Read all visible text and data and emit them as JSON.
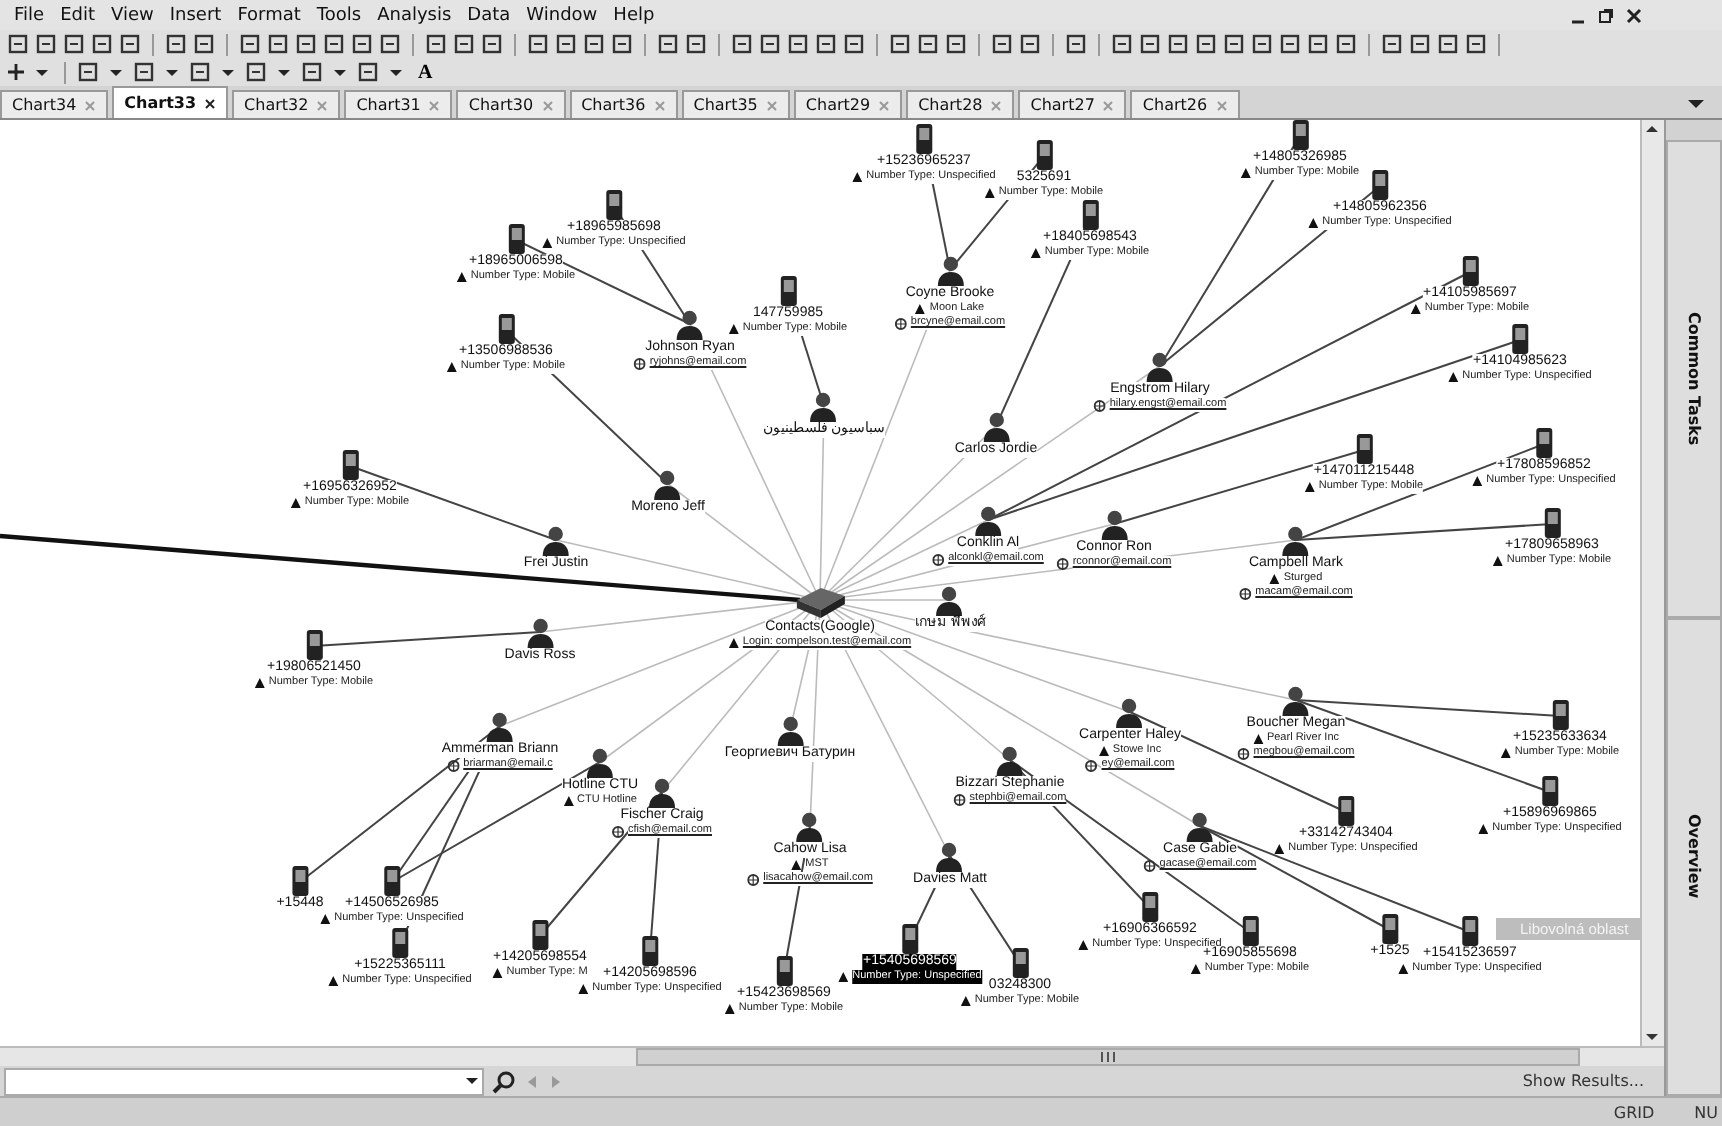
{
  "menu": [
    "File",
    "Edit",
    "View",
    "Insert",
    "Format",
    "Tools",
    "Analysis",
    "Data",
    "Window",
    "Help"
  ],
  "format_toolbar": {
    "text_button": "A"
  },
  "tabs": [
    {
      "label": "Chart34",
      "selected": false
    },
    {
      "label": "Chart33",
      "selected": true
    },
    {
      "label": "Chart32",
      "selected": false
    },
    {
      "label": "Chart31",
      "selected": false
    },
    {
      "label": "Chart30",
      "selected": false
    },
    {
      "label": "Chart36",
      "selected": false
    },
    {
      "label": "Chart35",
      "selected": false
    },
    {
      "label": "Chart29",
      "selected": false
    },
    {
      "label": "Chart28",
      "selected": false
    },
    {
      "label": "Chart27",
      "selected": false
    },
    {
      "label": "Chart26",
      "selected": false
    }
  ],
  "graph": {
    "nodes": [
      {
        "kind": "hub",
        "name": "Contacts(Google)",
        "login": "Login: compelson.test@email.com"
      },
      {
        "kind": "person",
        "name": "Johnson Ryan",
        "email": "ryjohns@email.com"
      },
      {
        "kind": "person",
        "name": "سباسيون فلسطينيون"
      },
      {
        "kind": "person",
        "name": "Moreno Jeff"
      },
      {
        "kind": "person",
        "name": "Frei Justin"
      },
      {
        "kind": "person",
        "name": "Coyne Brooke",
        "detail": "Moon Lake",
        "email": "brcyne@email.com"
      },
      {
        "kind": "person",
        "name": "Carlos Jordie"
      },
      {
        "kind": "person",
        "name": "Engstrom Hilary",
        "email": "hilary.engst@email.com"
      },
      {
        "kind": "person",
        "name": "Conklin Al",
        "email": "alconkl@email.com"
      },
      {
        "kind": "person",
        "name": "Connor Ron",
        "email": "rconnor@email.com"
      },
      {
        "kind": "person",
        "name": "Campbell Mark",
        "detail": "Sturged",
        "email": "macam@email.com"
      },
      {
        "kind": "person",
        "name": "เกษม พีพงศ์"
      },
      {
        "kind": "person",
        "name": "Davis Ross"
      },
      {
        "kind": "person",
        "name": "Ammerman Briann",
        "email": "briarman@email.c"
      },
      {
        "kind": "person",
        "name": "Hotline CTU",
        "detail": "CTU Hotline"
      },
      {
        "kind": "person",
        "name": "Fischer Craig",
        "email": "cfish@email.com"
      },
      {
        "kind": "person",
        "name": "Георгиевич Батурин"
      },
      {
        "kind": "person",
        "name": "Cahow Lisa",
        "detail": "MST",
        "email": "lisacahow@email.com"
      },
      {
        "kind": "person",
        "name": "Davies Matt"
      },
      {
        "kind": "person",
        "name": "Carpenter Haley",
        "detail": "Stowe Inc",
        "email": "ey@email.com"
      },
      {
        "kind": "person",
        "name": "Bizzari Stephanie",
        "email": "stephbi@email.com"
      },
      {
        "kind": "person",
        "name": "Boucher Megan",
        "detail": "Pearl River Inc",
        "email": "megbou@email.com"
      },
      {
        "kind": "person",
        "name": "Case Gabie",
        "email": "gacase@email.com"
      },
      {
        "kind": "phone",
        "number": "+18965985698",
        "type": "Number Type: Unspecified",
        "selected": false
      },
      {
        "kind": "phone",
        "number": "+18965006598",
        "type": "Number Type: Mobile",
        "selected": false
      },
      {
        "kind": "phone",
        "number": "+13506988536",
        "type": "Number Type: Mobile",
        "selected": false
      },
      {
        "kind": "phone",
        "number": "147759985",
        "type": "Number Type: Mobile",
        "selected": false
      },
      {
        "kind": "phone",
        "number": "+16956326952",
        "type": "Number Type: Mobile",
        "selected": false
      },
      {
        "kind": "phone",
        "number": "+15236965237",
        "type": "Number Type: Unspecified",
        "selected": false
      },
      {
        "kind": "phone",
        "number": "5325691",
        "type": "Number Type: Mobile",
        "selected": false
      },
      {
        "kind": "phone",
        "number": "+18405698543",
        "type": "Number Type: Mobile",
        "selected": false
      },
      {
        "kind": "phone",
        "number": "+14805326985",
        "type": "Number Type: Mobile",
        "selected": false
      },
      {
        "kind": "phone",
        "number": "+14805962356",
        "type": "Number Type: Unspecified",
        "selected": false
      },
      {
        "kind": "phone",
        "number": "+14105985697",
        "type": "Number Type: Mobile",
        "selected": false
      },
      {
        "kind": "phone",
        "number": "+14104985623",
        "type": "Number Type: Unspecified",
        "selected": false
      },
      {
        "kind": "phone",
        "number": "+147011215448",
        "type": "Number Type: Mobile",
        "selected": false
      },
      {
        "kind": "phone",
        "number": "+17808596852",
        "type": "Number Type: Unspecified",
        "selected": false
      },
      {
        "kind": "phone",
        "number": "+17809658963",
        "type": "Number Type: Mobile",
        "selected": false
      },
      {
        "kind": "phone",
        "number": "+19806521450",
        "type": "Number Type: Mobile",
        "selected": false
      },
      {
        "kind": "phone",
        "number": "+15235633634",
        "type": "Number Type: Mobile",
        "selected": false
      },
      {
        "kind": "phone",
        "number": "+15896969865",
        "type": "Number Type: Unspecified",
        "selected": false
      },
      {
        "kind": "phone",
        "number": "+33142743404",
        "type": "Number Type: Unspecified",
        "selected": false
      },
      {
        "kind": "phone",
        "number": "+16906366592",
        "type": "Number Type: Unspecified",
        "selected": false
      },
      {
        "kind": "phone",
        "number": "+16905855698",
        "type": "Number Type: Mobile",
        "selected": false
      },
      {
        "kind": "phone",
        "number": "+1525",
        "selected": false
      },
      {
        "kind": "phone",
        "number": "+15415236597",
        "type": "Number Type: Unspecified",
        "selected": false
      },
      {
        "kind": "phone",
        "number": "+15405698569",
        "type": "Number Type: Unspecified",
        "selected": true
      },
      {
        "kind": "phone",
        "number": "+15423698569",
        "type": "Number Type: Mobile",
        "selected": false
      },
      {
        "kind": "phone",
        "number": "03248300",
        "type": "Number Type: Mobile",
        "selected": false
      },
      {
        "kind": "phone",
        "number": "+15448",
        "selected": false
      },
      {
        "kind": "phone",
        "number": "+14506526985",
        "type": "Number Type: Unspecified",
        "selected": false
      },
      {
        "kind": "phone",
        "number": "+15225365111",
        "type": "Number Type: Unspecified",
        "selected": false
      },
      {
        "kind": "phone",
        "number": "+14205698554",
        "type": "Number Type: M",
        "selected": false
      },
      {
        "kind": "phone",
        "number": "+14205698596",
        "type": "Number Type: Unspecified",
        "selected": false
      }
    ]
  },
  "tooltip": "Libovolná oblast",
  "side_panel": [
    "Common Tasks",
    "Overview"
  ],
  "search_bar": {
    "show_results": "Show Results..."
  },
  "status_bar": [
    "GRID",
    "NU"
  ]
}
